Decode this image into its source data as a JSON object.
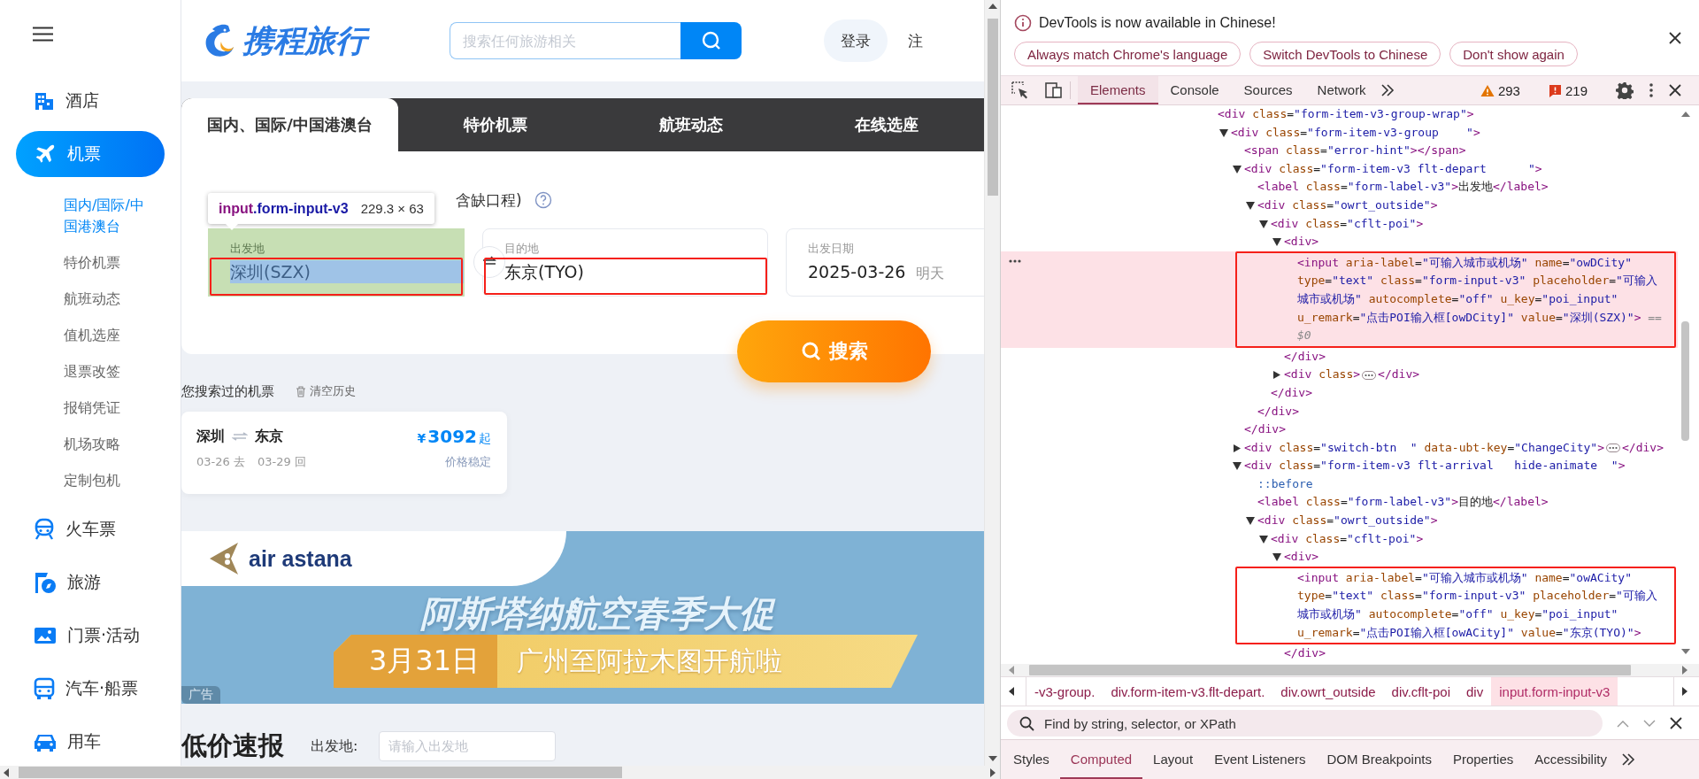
{
  "sidebar": {
    "items": [
      {
        "label": "酒店",
        "selected": false
      },
      {
        "label": "机票",
        "selected": true,
        "children": [
          {
            "label": "国内/国际/中国港澳台",
            "selected": true
          },
          {
            "label": "特价机票",
            "selected": false
          },
          {
            "label": "航班动态",
            "selected": false
          },
          {
            "label": "值机选座",
            "selected": false
          },
          {
            "label": "退票改签",
            "selected": false
          },
          {
            "label": "报销凭证",
            "selected": false
          },
          {
            "label": "机场攻略",
            "selected": false
          },
          {
            "label": "定制包机",
            "selected": false
          }
        ]
      },
      {
        "label": "火车票",
        "selected": false
      },
      {
        "label": "旅游",
        "selected": false
      },
      {
        "label": "门票·活动",
        "selected": false
      },
      {
        "label": "汽车·船票",
        "selected": false
      },
      {
        "label": "用车",
        "selected": false
      }
    ]
  },
  "header": {
    "logo": "携程旅行",
    "search": {
      "placeholder": "搜索任何旅游相关"
    },
    "login": "登录",
    "register": "注"
  },
  "flight_search": {
    "tabs": [
      {
        "label": "国内、国际/中国港澳台",
        "selected": true
      },
      {
        "label": "特价机票",
        "selected": false
      },
      {
        "label": "航班动态",
        "selected": false
      },
      {
        "label": "在线选座",
        "selected": false
      }
    ],
    "trip_option": "含缺口程)",
    "fields": [
      {
        "kind": "city",
        "label": "出发地",
        "value": "深圳(SZX)",
        "inspected": true
      },
      {
        "kind": "city",
        "label": "目的地",
        "value": "东京(TYO)",
        "inspected": false
      },
      {
        "kind": "date",
        "label": "出发日期",
        "value": "2025-03-26",
        "hint": "明天",
        "inspected": false
      }
    ],
    "search_button": "搜索"
  },
  "inspect_tooltip": {
    "selector": "input.form-input-v3",
    "size": "229.3 × 63"
  },
  "history": {
    "title": "您搜索过的机票",
    "clear": "清空历史",
    "cards": [
      {
        "from": "深圳",
        "to": "东京",
        "currency": "¥",
        "price": "3092",
        "price_suffix": "起",
        "depart": "03-26 去",
        "return": "03-29 回",
        "trend": "价格稳定"
      }
    ]
  },
  "ad": {
    "brand": "air astana",
    "headline": "阿斯塔纳航空春季大促",
    "date": "3月31日",
    "tagline": "广州至阿拉木图开航啦",
    "badge": "广告"
  },
  "deals": {
    "title": "低价速报",
    "from_label": "出发地:",
    "from_placeholder": "请输入出发地"
  },
  "devtools": {
    "infobar": {
      "message": "DevTools is now available in Chinese!",
      "buttons": [
        "Always match Chrome's language",
        "Switch DevTools to Chinese",
        "Don't show again"
      ]
    },
    "tabs": [
      {
        "label": "Elements",
        "selected": true
      },
      {
        "label": "Console",
        "selected": false
      },
      {
        "label": "Sources",
        "selected": false
      },
      {
        "label": "Network",
        "selected": false
      }
    ],
    "warnings": "293",
    "errors": "219",
    "dom_tree": {
      "text": "<div class=\"form-item-v3-group-wrap\">",
      "selected": false,
      "children": [
        {
          "text": "<div class=\"form-item-v3-group    \">",
          "expanded": true,
          "selected": false,
          "children": [
            {
              "text": "<span class=\"error-hint\"></span>",
              "selected": false
            },
            {
              "text": "<div class=\"form-item-v3 flt-depart      \">",
              "expanded": true,
              "selected": false,
              "closing": "</div>",
              "children": [
                {
                  "text": "<label class=\"form-label-v3\">出发地</label>",
                  "selected": false
                },
                {
                  "text": "<div class=\"owrt_outside\">",
                  "expanded": true,
                  "selected": false,
                  "closing": "</div>",
                  "children": [
                    {
                      "text": "<div class=\"cflt-poi\">",
                      "expanded": true,
                      "selected": false,
                      "closing": "</div>",
                      "children": [
                        {
                          "text": "<div>",
                          "expanded": true,
                          "selected": false,
                          "closing": "</div>",
                          "children": [
                            {
                              "text": "<input aria-label=\"可输入城市或机场\" name=\"owDCity\" type=\"text\" class=\"form-input-v3\" placeholder=\"可输入城市或机场\" autocomplete=\"off\" u_key=\"poi_input\" u_remark=\"点击POI输入框[owDCity]\" value=\"深圳(SZX)\">",
                              "selected": true,
                              "highlighted": true,
                              "suffix": "== $0"
                            }
                          ]
                        },
                        {
                          "text": "<div class>",
                          "expanded": false,
                          "selected": false,
                          "closing": "</div>"
                        }
                      ]
                    }
                  ]
                }
              ]
            },
            {
              "text": "<div class=\"switch-btn  \" data-ubt-key=\"ChangeCity\">",
              "expanded": false,
              "selected": false,
              "closing": "</div>"
            },
            {
              "text": "<div class=\"form-item-v3 flt-arrival   hide-animate  \">",
              "expanded": true,
              "selected": false,
              "children": [
                {
                  "text": "::before",
                  "selected": false
                },
                {
                  "text": "<label class=\"form-label-v3\">目的地</label>",
                  "selected": false
                },
                {
                  "text": "<div class=\"owrt_outside\">",
                  "expanded": true,
                  "selected": false,
                  "children": [
                    {
                      "text": "<div class=\"cflt-poi\">",
                      "expanded": true,
                      "selected": false,
                      "children": [
                        {
                          "text": "<div>",
                          "expanded": true,
                          "selected": false,
                          "closing": "</div>",
                          "children": [
                            {
                              "text": "<input aria-label=\"可输入城市或机场\" name=\"owACity\" type=\"text\" class=\"form-input-v3\" placeholder=\"可输入城市或机场\" autocomplete=\"off\" u_key=\"poi_input\" u_remark=\"点击POI输入框[owACity]\" value=\"东京(TYO)\">",
                              "selected": false,
                              "highlighted": true
                            }
                          ]
                        }
                      ]
                    }
                  ]
                }
              ]
            }
          ]
        }
      ]
    },
    "breadcrumbs": [
      {
        "label": "-v3-group.",
        "selected": false
      },
      {
        "label": "div.form-item-v3.flt-depart.",
        "selected": false
      },
      {
        "label": "div.owrt_outside",
        "selected": false
      },
      {
        "label": "div.cflt-poi",
        "selected": false
      },
      {
        "label": "div",
        "selected": false
      },
      {
        "label": "input.form-input-v3",
        "selected": true
      }
    ],
    "filter": {
      "placeholder": "Find by string, selector, or XPath"
    },
    "panel_tabs": [
      {
        "label": "Styles",
        "selected": false
      },
      {
        "label": "Computed",
        "selected": true
      },
      {
        "label": "Layout",
        "selected": false
      },
      {
        "label": "Event Listeners",
        "selected": false
      },
      {
        "label": "DOM Breakpoints",
        "selected": false
      },
      {
        "label": "Properties",
        "selected": false
      },
      {
        "label": "Accessibility",
        "selected": false
      }
    ]
  }
}
